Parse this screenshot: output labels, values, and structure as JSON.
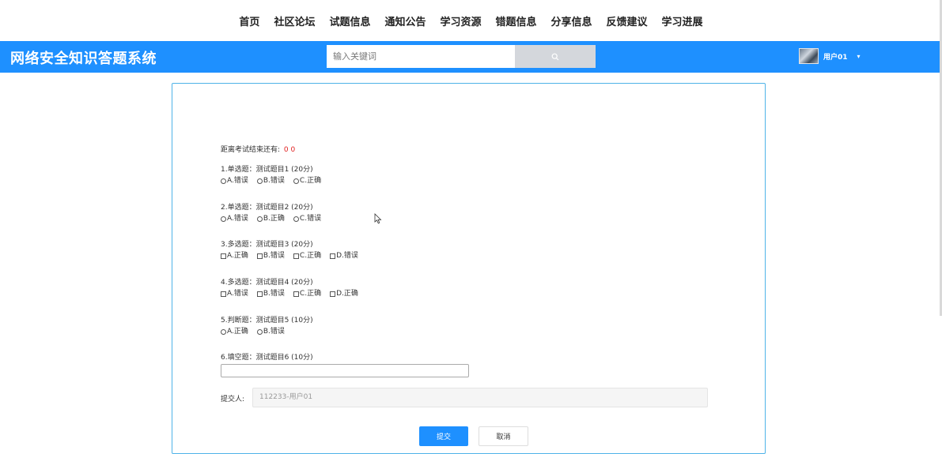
{
  "nav": {
    "items": [
      {
        "label": "首页"
      },
      {
        "label": "社区论坛"
      },
      {
        "label": "试题信息"
      },
      {
        "label": "通知公告"
      },
      {
        "label": "学习资源"
      },
      {
        "label": "错题信息"
      },
      {
        "label": "分享信息"
      },
      {
        "label": "反馈建议"
      },
      {
        "label": "学习进展"
      }
    ]
  },
  "header": {
    "brand": "网络安全知识答题系统",
    "search_placeholder": "输入关键词",
    "search_icon": "search-icon",
    "user_name": "用户01",
    "accent_color": "#1e90ff"
  },
  "exam": {
    "timer_label": "距离考试结束还有:",
    "timer_value": "0 0",
    "questions": [
      {
        "title": "1.单选题：测试题目1 (20分)",
        "type": "radio",
        "options": [
          "A.错误",
          "B.错误",
          "C.正确"
        ]
      },
      {
        "title": "2.单选题：测试题目2 (20分)",
        "type": "radio",
        "options": [
          "A.错误",
          "B.正确",
          "C.错误"
        ]
      },
      {
        "title": "3.多选题：测试题目3 (20分)",
        "type": "checkbox",
        "options": [
          "A.正确",
          "B.错误",
          "C.正确",
          "D.错误"
        ]
      },
      {
        "title": "4.多选题：测试题目4 (20分)",
        "type": "checkbox",
        "options": [
          "A.错误",
          "B.错误",
          "C.正确",
          "D.正确"
        ]
      },
      {
        "title": "5.判断题：测试题目5 (10分)",
        "type": "radio",
        "options": [
          "A.正确",
          "B.错误"
        ]
      },
      {
        "title": "6.填空题：测试题目6 (10分)",
        "type": "text",
        "options": []
      }
    ],
    "submitter_label": "提交人:",
    "submitter_value": "112233-用户01",
    "submit_label": "提交",
    "cancel_label": "取消"
  }
}
